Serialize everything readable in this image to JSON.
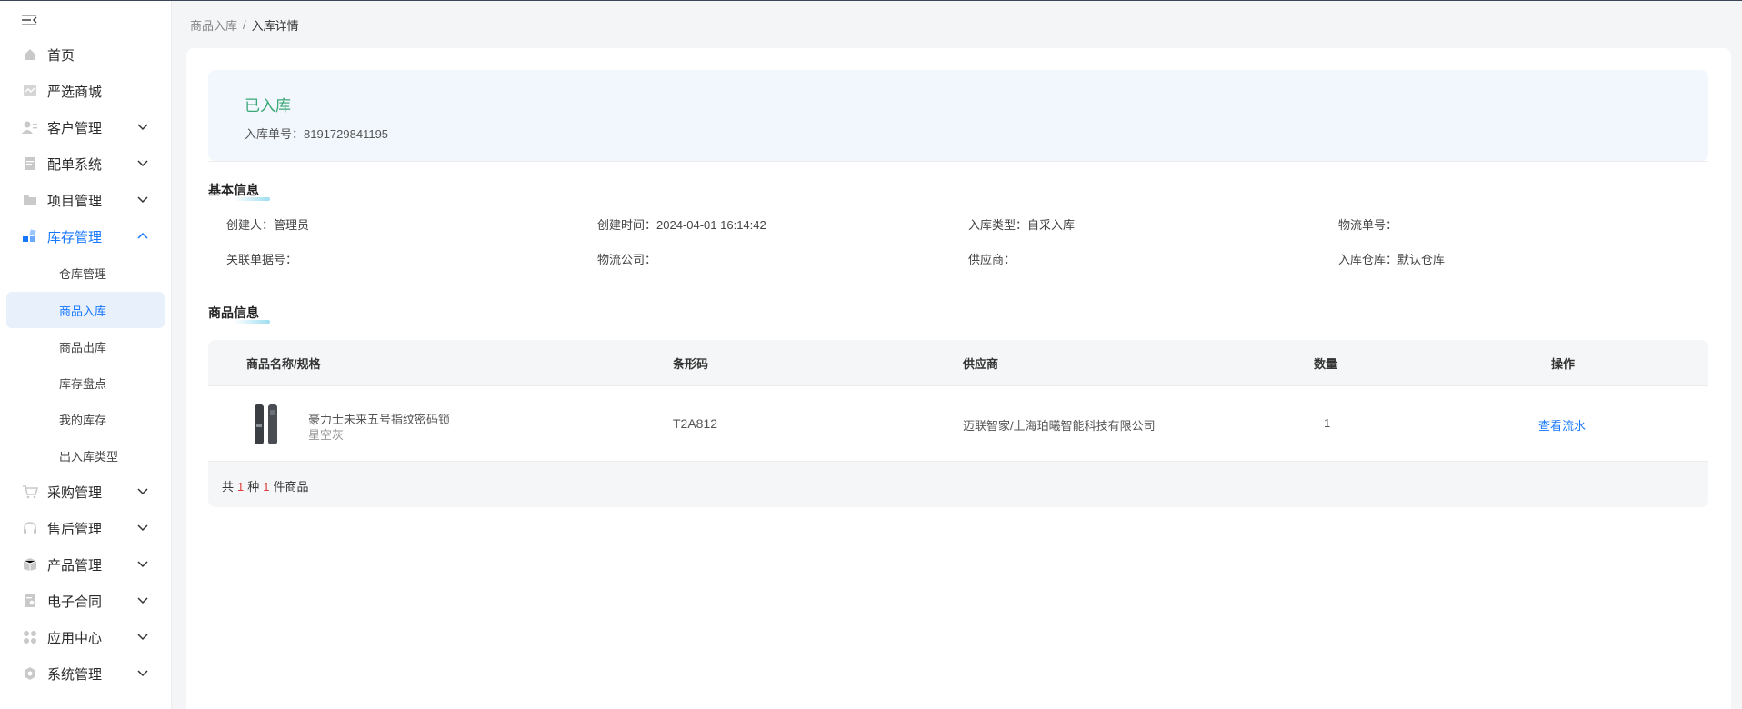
{
  "sidebar": {
    "items": [
      {
        "label": "首页",
        "icon": "home-icon"
      },
      {
        "label": "严选商城",
        "icon": "store-icon"
      },
      {
        "label": "客户管理",
        "icon": "customer-icon"
      },
      {
        "label": "配单系统",
        "icon": "document-icon"
      },
      {
        "label": "项目管理",
        "icon": "folder-icon"
      },
      {
        "label": "库存管理",
        "icon": "inventory-icon"
      },
      {
        "label": "采购管理",
        "icon": "cart-icon"
      },
      {
        "label": "售后管理",
        "icon": "headset-icon"
      },
      {
        "label": "产品管理",
        "icon": "box-icon"
      },
      {
        "label": "电子合同",
        "icon": "contract-icon"
      },
      {
        "label": "应用中心",
        "icon": "apps-icon"
      },
      {
        "label": "系统管理",
        "icon": "settings-icon"
      }
    ],
    "sub_items": [
      "仓库管理",
      "商品入库",
      "商品出库",
      "库存盘点",
      "我的库存",
      "出入库类型"
    ],
    "active_sub": "商品入库",
    "accent_color": "#1677ff"
  },
  "breadcrumb": {
    "parent": "商品入库",
    "separator": "/",
    "current": "入库详情"
  },
  "status": {
    "text": "已入库",
    "order_no_label": "入库单号：",
    "order_no": "8191729841195",
    "color": "#3aa776"
  },
  "basic_info": {
    "title": "基本信息",
    "fields": [
      {
        "label": "创建人：",
        "value": "管理员"
      },
      {
        "label": "创建时间：",
        "value": "2024-04-01 16:14:42"
      },
      {
        "label": "入库类型：",
        "value": "自采入库"
      },
      {
        "label": "物流单号：",
        "value": ""
      },
      {
        "label": "关联单据号：",
        "value": ""
      },
      {
        "label": "物流公司：",
        "value": ""
      },
      {
        "label": "供应商：",
        "value": ""
      },
      {
        "label": "入库仓库：",
        "value": "默认仓库"
      }
    ]
  },
  "product_info": {
    "title": "商品信息",
    "columns": [
      "商品名称/规格",
      "条形码",
      "供应商",
      "数量",
      "操作"
    ],
    "rows": [
      {
        "name": "豪力士未来五号指纹密码锁",
        "spec": "星空灰",
        "barcode": "T2A812",
        "supplier": "迈联智家/上海珀曦智能科技有限公司",
        "quantity": "1",
        "action": "查看流水"
      }
    ],
    "summary": {
      "prefix": "共",
      "kinds": "1",
      "middle": "种",
      "count": "1",
      "suffix": "件商品"
    }
  }
}
